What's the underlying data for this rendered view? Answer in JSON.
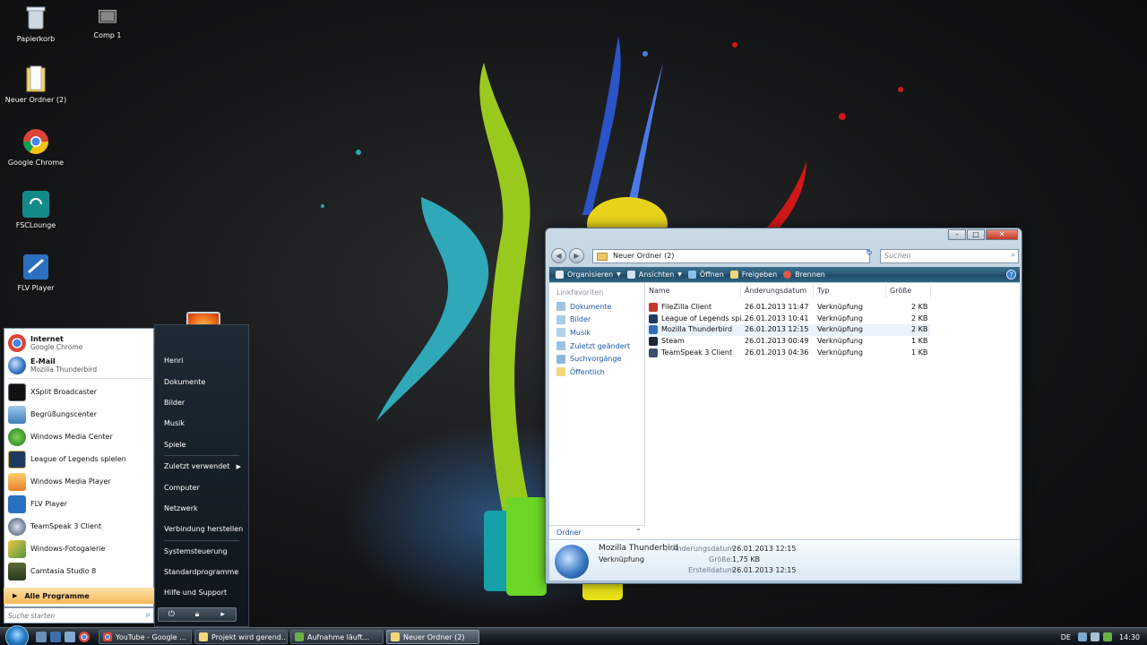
{
  "desktop": {
    "icons": [
      {
        "label": "Papierkorb",
        "icon": "recycle-bin-icon"
      },
      {
        "label": "Comp 1",
        "icon": "video-file-icon"
      },
      {
        "label": "Neuer Ordner (2)",
        "icon": "folder-icon"
      },
      {
        "label": "Google Chrome",
        "icon": "chrome-icon"
      },
      {
        "label": "FSCLounge",
        "icon": "fsclounge-icon"
      },
      {
        "label": "FLV Player",
        "icon": "flv-player-icon"
      }
    ]
  },
  "start_menu": {
    "pinned": [
      {
        "title": "Internet",
        "subtitle": "Google Chrome",
        "icon": "chrome-icon"
      },
      {
        "title": "E-Mail",
        "subtitle": "Mozilla Thunderbird",
        "icon": "thunderbird-icon"
      }
    ],
    "recent": [
      {
        "label": "XSplit Broadcaster",
        "icon": "xsplit-icon"
      },
      {
        "label": "Begrüßungscenter",
        "icon": "welcome-center-icon"
      },
      {
        "label": "Windows Media Center",
        "icon": "media-center-icon"
      },
      {
        "label": "League of Legends spielen",
        "icon": "league-icon"
      },
      {
        "label": "Windows Media Player",
        "icon": "media-player-icon"
      },
      {
        "label": "FLV Player",
        "icon": "flv-player-icon"
      },
      {
        "label": "TeamSpeak 3 Client",
        "icon": "teamspeak-icon"
      },
      {
        "label": "Windows-Fotogalerie",
        "icon": "photo-gallery-icon"
      },
      {
        "label": "Camtasia Studio 8",
        "icon": "camtasia-icon"
      }
    ],
    "all_programs": "Alle Programme",
    "search_placeholder": "Suche starten",
    "right_items": [
      "Henri",
      "Dokumente",
      "Bilder",
      "Musik",
      "Spiele",
      "Zuletzt verwendet",
      "Computer",
      "Netzwerk",
      "Verbindung herstellen",
      "Systemsteuerung",
      "Standardprogramme",
      "Hilfe und Support"
    ]
  },
  "explorer": {
    "address": "Neuer Ordner (2)",
    "search_placeholder": "Suchen",
    "toolbar": {
      "organize": "Organisieren",
      "views": "Ansichten",
      "open": "Öffnen",
      "share": "Freigeben",
      "burn": "Brennen"
    },
    "nav_header": "Linkfavoriten",
    "nav_items": [
      "Dokumente",
      "Bilder",
      "Musik",
      "Zuletzt geändert",
      "Suchvorgänge",
      "Öffentlich"
    ],
    "folders_label": "Ordner",
    "columns": [
      "Name",
      "Änderungsdatum",
      "Typ",
      "Größe"
    ],
    "files": [
      {
        "name": "FileZilla Client",
        "date": "26.01.2013 11:47",
        "type": "Verknüpfung",
        "size": "2 KB",
        "color": "#c0392b"
      },
      {
        "name": "League of Legends spi...",
        "date": "26.01.2013 10:41",
        "type": "Verknüpfung",
        "size": "2 KB",
        "color": "#1f3a5f"
      },
      {
        "name": "Mozilla Thunderbird",
        "date": "26.01.2013 12:15",
        "type": "Verknüpfung",
        "size": "2 KB",
        "color": "#2f6fb8"
      },
      {
        "name": "Steam",
        "date": "26.01.2013 00:49",
        "type": "Verknüpfung",
        "size": "1 KB",
        "color": "#1b2838"
      },
      {
        "name": "TeamSpeak 3 Client",
        "date": "26.01.2013 04:36",
        "type": "Verknüpfung",
        "size": "1 KB",
        "color": "#3a4f70"
      }
    ],
    "selected_index": 2,
    "details": {
      "name": "Mozilla Thunderbird",
      "kind": "Verknüpfung",
      "modified_label": "Änderungsdatum:",
      "modified": "26.01.2013 12:15",
      "size_label": "Größe:",
      "size": "1,75 KB",
      "created_label": "Erstelldatum:",
      "created": "26.01.2013 12:15"
    }
  },
  "taskbar": {
    "buttons": [
      {
        "label": "YouTube - Google ...",
        "icon": "chrome-icon"
      },
      {
        "label": "Projekt wird gerend...",
        "icon": "folder-icon"
      },
      {
        "label": "Aufnahme läuft...",
        "icon": "recording-icon"
      },
      {
        "label": "Neuer Ordner (2)",
        "icon": "folder-icon"
      }
    ],
    "language": "DE",
    "clock": "14:30"
  }
}
